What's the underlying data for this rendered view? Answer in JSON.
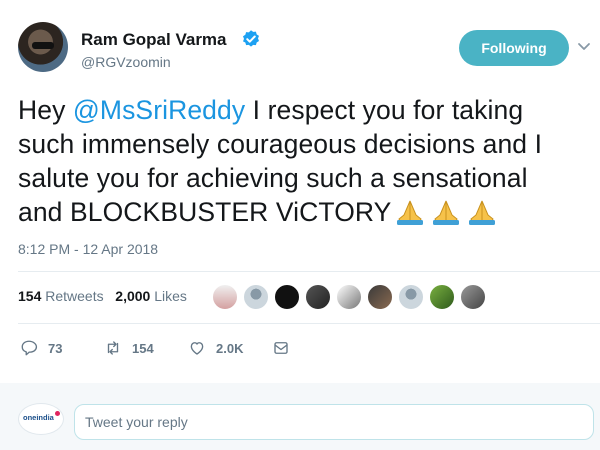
{
  "author": {
    "name": "Ram Gopal Varma",
    "handle": "@RGVzoomin",
    "follow_label": "Following"
  },
  "tweet": {
    "text_before": "Hey ",
    "mention": "@MsSriReddy",
    "text_after": " I respect you for taking such immensely courageous decisions and I salute you for achieving such a sensational and BLOCKBUSTER ViCTORY",
    "emojis": [
      "folded-hands",
      "folded-hands",
      "folded-hands"
    ],
    "timestamp": "8:12 PM - 12 Apr 2018"
  },
  "stats": {
    "retweets_count": "154",
    "retweets_label": "Retweets",
    "likes_count": "2,000",
    "likes_label": "Likes",
    "liker_avatar_count": 9
  },
  "actions": {
    "reply_count": "73",
    "retweet_count": "154",
    "like_count": "2.0K"
  },
  "reply_box": {
    "placeholder": "Tweet your reply",
    "logo_text": "oneindia"
  },
  "colors": {
    "accent": "#1b95e0",
    "follow_button": "#4ab3c5",
    "verified": "#1da1f2",
    "secondary_text": "#657786"
  }
}
